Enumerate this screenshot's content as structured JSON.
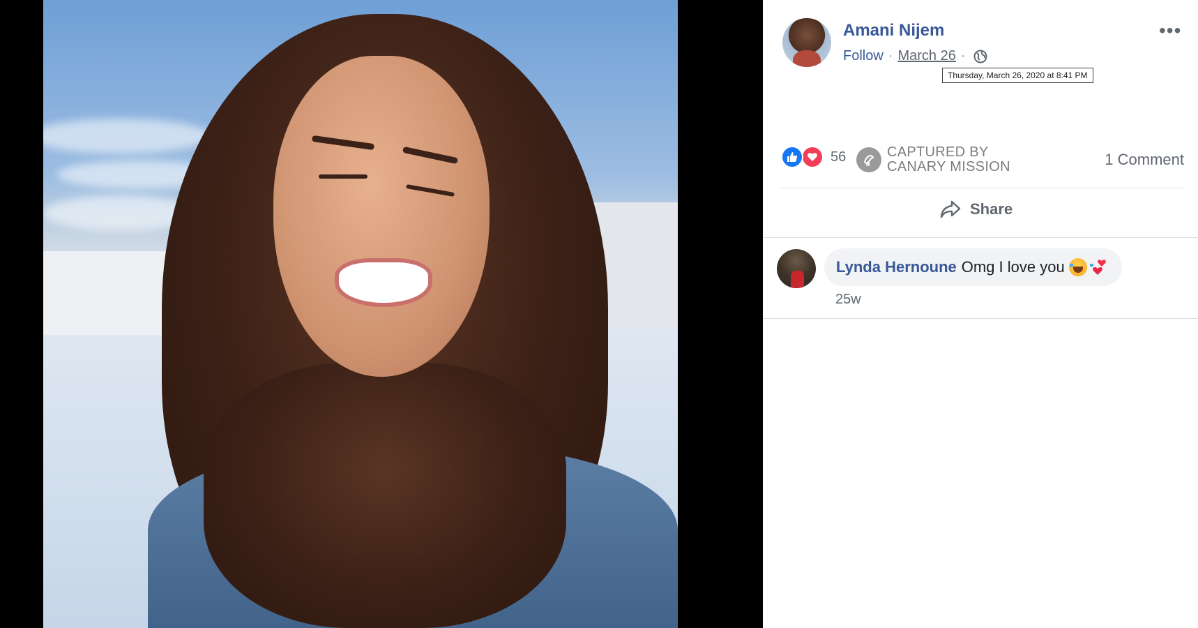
{
  "post": {
    "author": "Amani Nijem",
    "follow_label": "Follow",
    "separator": "·",
    "date": "March 26",
    "date_tooltip": "Thursday, March 26, 2020 at 8:41 PM",
    "more_label": "•••",
    "privacy_icon": "globe-icon"
  },
  "reactions": {
    "icons": [
      "like-icon",
      "love-icon"
    ],
    "count": "56",
    "badge_icon": "canary-icon",
    "badge_line1": "CAPTURED BY",
    "badge_line2": "CANARY MISSION",
    "comment_count": "1 Comment"
  },
  "actions": {
    "share_label": "Share"
  },
  "comments": [
    {
      "author": "Lynda Hernoune",
      "text": "Omg I love you",
      "emojis": [
        "laughing-tears-emoji",
        "two-hearts-emoji"
      ],
      "time": "25w"
    }
  ],
  "colors": {
    "link_blue": "#385898",
    "like_blue": "#1877f2",
    "love_red": "#f33e58",
    "secondary_text": "#606770"
  }
}
